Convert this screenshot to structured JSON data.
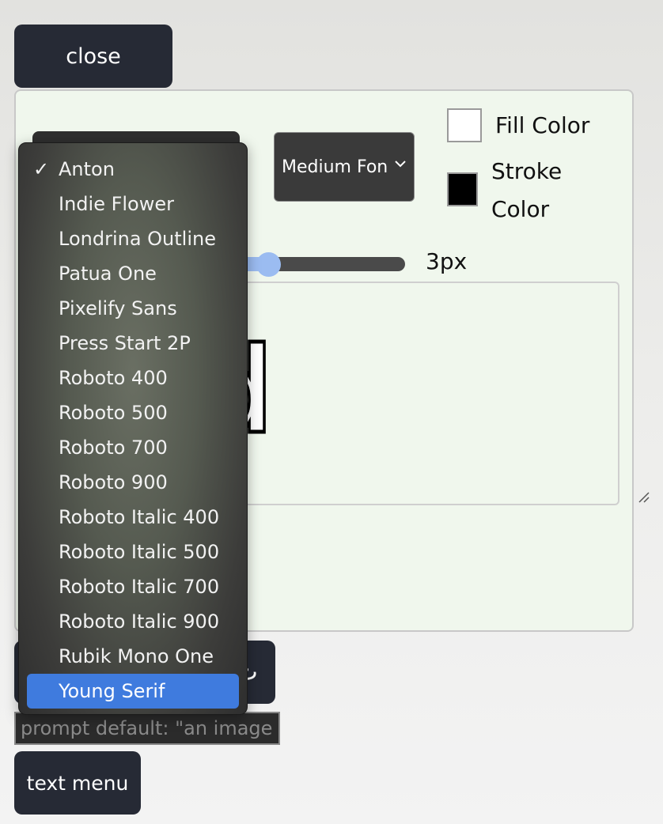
{
  "close_button": "close",
  "controls": {
    "size_select_label": "Medium Font",
    "fill_color_label": "Fill Color",
    "stroke_color_label": "Stroke Color",
    "fill_color": "#ffffff",
    "stroke_color": "#000000",
    "stroke_width_value": "3px"
  },
  "preview": {
    "text": "acked"
  },
  "font_menu": {
    "selected": "Anton",
    "highlighted": "Young Serif",
    "check_glyph": "✓",
    "items": [
      "Anton",
      "Indie Flower",
      "Londrina Outline",
      "Patua One",
      "Pixelify Sans",
      "Press Start 2P",
      "Roboto 400",
      "Roboto 500",
      "Roboto 700",
      "Roboto 900",
      "Roboto Italic 400",
      "Roboto Italic 500",
      "Roboto Italic 700",
      "Roboto Italic 900",
      "Rubik Mono One",
      "Young Serif"
    ]
  },
  "prompt": {
    "placeholder": "prompt default: \"an image\""
  },
  "text_menu_button": "text menu",
  "bottom_button_glyph": "ٹ"
}
